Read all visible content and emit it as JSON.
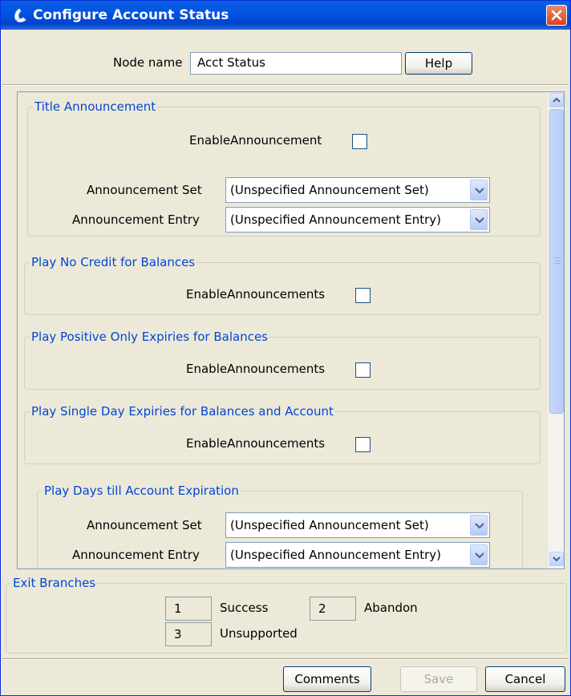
{
  "window": {
    "title": "Configure Account Status",
    "title_icon": "phone-handset-icon",
    "close_icon": "close-icon"
  },
  "node": {
    "label": "Node name",
    "value": "Acct Status",
    "help_label": "Help"
  },
  "groups": {
    "title_announcement": {
      "title": "Title Announcement",
      "enable_label": "EnableAnnouncement",
      "set_label": "Announcement Set",
      "set_value": "(Unspecified Announcement Set)",
      "entry_label": "Announcement Entry",
      "entry_value": "(Unspecified Announcement Entry)"
    },
    "no_credit": {
      "title": "Play No Credit for Balances",
      "enable_label": "EnableAnnouncements"
    },
    "positive_expiries": {
      "title": "Play Positive Only Expiries for Balances",
      "enable_label": "EnableAnnouncements"
    },
    "single_day": {
      "title": "Play Single Day Expiries for Balances and Account",
      "enable_label": "EnableAnnouncements"
    },
    "days_till": {
      "title": "Play Days till Account Expiration",
      "set_label": "Announcement Set",
      "set_value": "(Unspecified Announcement Set)",
      "entry_label": "Announcement Entry",
      "entry_value": "(Unspecified Announcement Entry)"
    }
  },
  "exit_branches": {
    "title": "Exit Branches",
    "items": [
      {
        "number": "1",
        "label": "Success"
      },
      {
        "number": "2",
        "label": "Abandon"
      },
      {
        "number": "3",
        "label": "Unsupported"
      }
    ]
  },
  "footer": {
    "comments_label": "Comments",
    "save_label": "Save",
    "cancel_label": "Cancel"
  },
  "colors": {
    "titlebar": "#0054e3",
    "group_title": "#0046d5",
    "background": "#ece9d8"
  }
}
